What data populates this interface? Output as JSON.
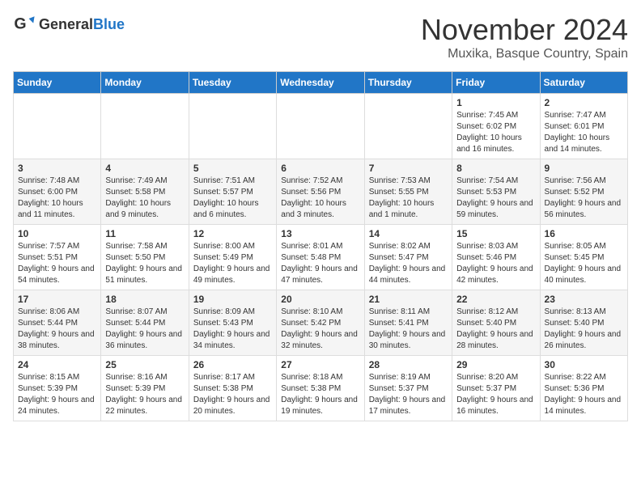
{
  "logo": {
    "text_general": "General",
    "text_blue": "Blue"
  },
  "title": {
    "month": "November 2024",
    "location": "Muxika, Basque Country, Spain"
  },
  "days_of_week": [
    "Sunday",
    "Monday",
    "Tuesday",
    "Wednesday",
    "Thursday",
    "Friday",
    "Saturday"
  ],
  "weeks": [
    [
      {
        "day": "",
        "info": ""
      },
      {
        "day": "",
        "info": ""
      },
      {
        "day": "",
        "info": ""
      },
      {
        "day": "",
        "info": ""
      },
      {
        "day": "",
        "info": ""
      },
      {
        "day": "1",
        "info": "Sunrise: 7:45 AM\nSunset: 6:02 PM\nDaylight: 10 hours and 16 minutes."
      },
      {
        "day": "2",
        "info": "Sunrise: 7:47 AM\nSunset: 6:01 PM\nDaylight: 10 hours and 14 minutes."
      }
    ],
    [
      {
        "day": "3",
        "info": "Sunrise: 7:48 AM\nSunset: 6:00 PM\nDaylight: 10 hours and 11 minutes."
      },
      {
        "day": "4",
        "info": "Sunrise: 7:49 AM\nSunset: 5:58 PM\nDaylight: 10 hours and 9 minutes."
      },
      {
        "day": "5",
        "info": "Sunrise: 7:51 AM\nSunset: 5:57 PM\nDaylight: 10 hours and 6 minutes."
      },
      {
        "day": "6",
        "info": "Sunrise: 7:52 AM\nSunset: 5:56 PM\nDaylight: 10 hours and 3 minutes."
      },
      {
        "day": "7",
        "info": "Sunrise: 7:53 AM\nSunset: 5:55 PM\nDaylight: 10 hours and 1 minute."
      },
      {
        "day": "8",
        "info": "Sunrise: 7:54 AM\nSunset: 5:53 PM\nDaylight: 9 hours and 59 minutes."
      },
      {
        "day": "9",
        "info": "Sunrise: 7:56 AM\nSunset: 5:52 PM\nDaylight: 9 hours and 56 minutes."
      }
    ],
    [
      {
        "day": "10",
        "info": "Sunrise: 7:57 AM\nSunset: 5:51 PM\nDaylight: 9 hours and 54 minutes."
      },
      {
        "day": "11",
        "info": "Sunrise: 7:58 AM\nSunset: 5:50 PM\nDaylight: 9 hours and 51 minutes."
      },
      {
        "day": "12",
        "info": "Sunrise: 8:00 AM\nSunset: 5:49 PM\nDaylight: 9 hours and 49 minutes."
      },
      {
        "day": "13",
        "info": "Sunrise: 8:01 AM\nSunset: 5:48 PM\nDaylight: 9 hours and 47 minutes."
      },
      {
        "day": "14",
        "info": "Sunrise: 8:02 AM\nSunset: 5:47 PM\nDaylight: 9 hours and 44 minutes."
      },
      {
        "day": "15",
        "info": "Sunrise: 8:03 AM\nSunset: 5:46 PM\nDaylight: 9 hours and 42 minutes."
      },
      {
        "day": "16",
        "info": "Sunrise: 8:05 AM\nSunset: 5:45 PM\nDaylight: 9 hours and 40 minutes."
      }
    ],
    [
      {
        "day": "17",
        "info": "Sunrise: 8:06 AM\nSunset: 5:44 PM\nDaylight: 9 hours and 38 minutes."
      },
      {
        "day": "18",
        "info": "Sunrise: 8:07 AM\nSunset: 5:44 PM\nDaylight: 9 hours and 36 minutes."
      },
      {
        "day": "19",
        "info": "Sunrise: 8:09 AM\nSunset: 5:43 PM\nDaylight: 9 hours and 34 minutes."
      },
      {
        "day": "20",
        "info": "Sunrise: 8:10 AM\nSunset: 5:42 PM\nDaylight: 9 hours and 32 minutes."
      },
      {
        "day": "21",
        "info": "Sunrise: 8:11 AM\nSunset: 5:41 PM\nDaylight: 9 hours and 30 minutes."
      },
      {
        "day": "22",
        "info": "Sunrise: 8:12 AM\nSunset: 5:40 PM\nDaylight: 9 hours and 28 minutes."
      },
      {
        "day": "23",
        "info": "Sunrise: 8:13 AM\nSunset: 5:40 PM\nDaylight: 9 hours and 26 minutes."
      }
    ],
    [
      {
        "day": "24",
        "info": "Sunrise: 8:15 AM\nSunset: 5:39 PM\nDaylight: 9 hours and 24 minutes."
      },
      {
        "day": "25",
        "info": "Sunrise: 8:16 AM\nSunset: 5:39 PM\nDaylight: 9 hours and 22 minutes."
      },
      {
        "day": "26",
        "info": "Sunrise: 8:17 AM\nSunset: 5:38 PM\nDaylight: 9 hours and 20 minutes."
      },
      {
        "day": "27",
        "info": "Sunrise: 8:18 AM\nSunset: 5:38 PM\nDaylight: 9 hours and 19 minutes."
      },
      {
        "day": "28",
        "info": "Sunrise: 8:19 AM\nSunset: 5:37 PM\nDaylight: 9 hours and 17 minutes."
      },
      {
        "day": "29",
        "info": "Sunrise: 8:20 AM\nSunset: 5:37 PM\nDaylight: 9 hours and 16 minutes."
      },
      {
        "day": "30",
        "info": "Sunrise: 8:22 AM\nSunset: 5:36 PM\nDaylight: 9 hours and 14 minutes."
      }
    ]
  ]
}
